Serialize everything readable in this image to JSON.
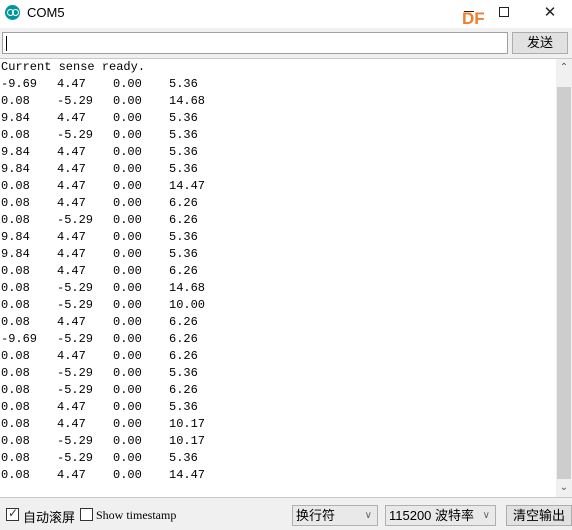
{
  "window": {
    "title": "COM5",
    "app_icon": "arduino-icon",
    "watermark": "DF",
    "controls": {
      "minimize": "minimize-icon",
      "maximize": "maximize-icon",
      "close": "close-icon"
    },
    "close_glyph": "✕"
  },
  "send_bar": {
    "input_value": "",
    "send_label": "发送"
  },
  "output": {
    "header_line": "Current sense ready.",
    "rows": [
      [
        "-9.69",
        "4.47",
        "0.00",
        "5.36"
      ],
      [
        "0.08",
        "-5.29",
        "0.00",
        "14.68"
      ],
      [
        "9.84",
        "4.47",
        "0.00",
        "5.36"
      ],
      [
        "0.08",
        "-5.29",
        "0.00",
        "5.36"
      ],
      [
        "9.84",
        "4.47",
        "0.00",
        "5.36"
      ],
      [
        "9.84",
        "4.47",
        "0.00",
        "5.36"
      ],
      [
        "0.08",
        "4.47",
        "0.00",
        "14.47"
      ],
      [
        "0.08",
        "4.47",
        "0.00",
        "6.26"
      ],
      [
        "0.08",
        "-5.29",
        "0.00",
        "6.26"
      ],
      [
        "9.84",
        "4.47",
        "0.00",
        "5.36"
      ],
      [
        "9.84",
        "4.47",
        "0.00",
        "5.36"
      ],
      [
        "0.08",
        "4.47",
        "0.00",
        "6.26"
      ],
      [
        "0.08",
        "-5.29",
        "0.00",
        "14.68"
      ],
      [
        "0.08",
        "-5.29",
        "0.00",
        "10.00"
      ],
      [
        "0.08",
        "4.47",
        "0.00",
        "6.26"
      ],
      [
        "-9.69",
        "-5.29",
        "0.00",
        "6.26"
      ],
      [
        "0.08",
        "4.47",
        "0.00",
        "6.26"
      ],
      [
        "0.08",
        "-5.29",
        "0.00",
        "5.36"
      ],
      [
        "0.08",
        "-5.29",
        "0.00",
        "6.26"
      ],
      [
        "0.08",
        "4.47",
        "0.00",
        "5.36"
      ],
      [
        "0.08",
        "4.47",
        "0.00",
        "10.17"
      ],
      [
        "0.08",
        "-5.29",
        "0.00",
        "10.17"
      ],
      [
        "0.08",
        "-5.29",
        "0.00",
        "5.36"
      ],
      [
        "0.08",
        "4.47",
        "0.00",
        "14.47"
      ]
    ]
  },
  "scrollbar": {
    "up_glyph": "⌃",
    "down_glyph": "⌄"
  },
  "footer": {
    "autoscroll_label": "自动滚屏",
    "autoscroll_checked": true,
    "check_glyph": "✓",
    "timestamp_label": "Show timestamp",
    "timestamp_checked": false,
    "line_ending_selected": "换行符",
    "baud_selected": "115200 波特率",
    "dropdown_glyph": "∨",
    "clear_label": "清空输出"
  },
  "colors": {
    "arduino_teal": "#00979c",
    "watermark_orange": "#f08030",
    "panel_bg": "#f0f0f0"
  }
}
